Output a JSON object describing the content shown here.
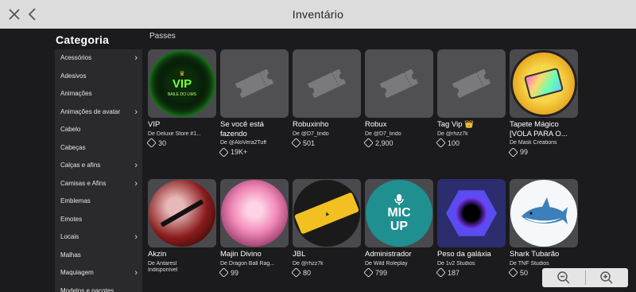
{
  "window": {
    "title": "Inventário"
  },
  "sidebar": {
    "title": "Categoria",
    "items": [
      {
        "label": "Acessórios",
        "chevron": true
      },
      {
        "label": "Adesivos",
        "chevron": false
      },
      {
        "label": "Animações",
        "chevron": false
      },
      {
        "label": "Animações de avatar",
        "chevron": true
      },
      {
        "label": "Cabelo",
        "chevron": false
      },
      {
        "label": "Cabeças",
        "chevron": false
      },
      {
        "label": "Calças e afins",
        "chevron": true
      },
      {
        "label": "Camisas e Afins",
        "chevron": true
      },
      {
        "label": "Emblemas",
        "chevron": false
      },
      {
        "label": "Emotes",
        "chevron": false
      },
      {
        "label": "Locais",
        "chevron": true
      },
      {
        "label": "Malhas",
        "chevron": false
      },
      {
        "label": "Maquiagem",
        "chevron": true
      },
      {
        "label": "Modelos e pacotes",
        "chevron": false
      }
    ]
  },
  "main": {
    "section": "Passes",
    "row1": [
      {
        "name": "VIP",
        "by": "De Deluxe Store #1...",
        "price": "30",
        "thumb": "vip",
        "thumb_text": "VIP",
        "thumb_sub": "BAILE DO LIMS"
      },
      {
        "name": "Se você está fazendo",
        "by": "De @AloVera2Tuff",
        "price": "19K+",
        "thumb": "ticket"
      },
      {
        "name": "Robuxinho",
        "by": "De @D7_lindo",
        "price": "501",
        "thumb": "ticket"
      },
      {
        "name": "Robux",
        "by": "De @D7_lindo",
        "price": "2,900",
        "thumb": "ticket"
      },
      {
        "name": "Tag Vip 👑",
        "by": "De @rhzz7k",
        "price": "100",
        "thumb": "ticket"
      },
      {
        "name": "Tapete Mágico [VOLA PARA O...",
        "by": "De Mask Creations",
        "price": "99",
        "thumb": "carpet"
      }
    ],
    "row2": [
      {
        "name": "Akzin",
        "by": "De Antaresl",
        "by2": "Indisponível",
        "price": "",
        "thumb": "akzin"
      },
      {
        "name": "Majin Divino",
        "by": "De Dragon Ball Rag...",
        "price": "99",
        "thumb": "majin"
      },
      {
        "name": "JBL",
        "by": "De @rhzz7k",
        "price": "80",
        "thumb": "jbl"
      },
      {
        "name": "Administrador",
        "by": "De Wild Roleplay",
        "price": "799",
        "thumb": "mic",
        "thumb_text": "MIC",
        "thumb_sub": "UP"
      },
      {
        "name": "Peso da galáxia",
        "by": "De 1v2 Studios",
        "price": "187",
        "thumb": "galaxy"
      },
      {
        "name": "Shark Tubarão",
        "by": "De TNF Studios",
        "price": "50",
        "thumb": "shark"
      }
    ]
  },
  "colors": {
    "topbar": "#dcdcdc",
    "background": "#1b1b1d",
    "sidebar_panel": "#2a2a2c",
    "card": "#4a4a4e"
  },
  "icons": {
    "close": "close-icon",
    "back": "back-icon",
    "currency": "robux-icon",
    "zoom_out": "zoom-out-icon",
    "zoom_in": "zoom-in-icon"
  }
}
